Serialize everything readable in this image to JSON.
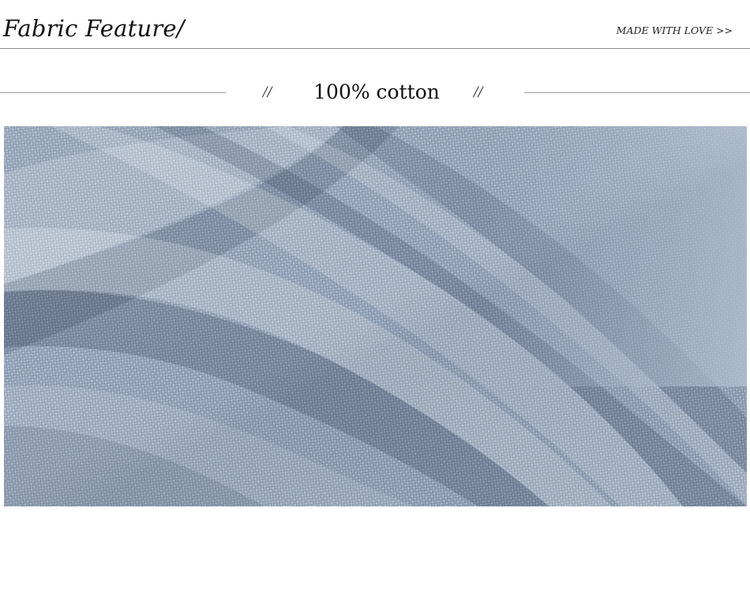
{
  "header": {
    "title": "Fabric Feature/",
    "tagline": "MADE WITH LOVE >>"
  },
  "section": {
    "heading": "100% cotton",
    "left_divider": "//",
    "right_divider": "//"
  },
  "photo": {
    "subject": "fabric-closeup",
    "colors": {
      "base": "#8e9fb5",
      "light": "#c9d2de",
      "shadow": "#5d6e86"
    }
  }
}
